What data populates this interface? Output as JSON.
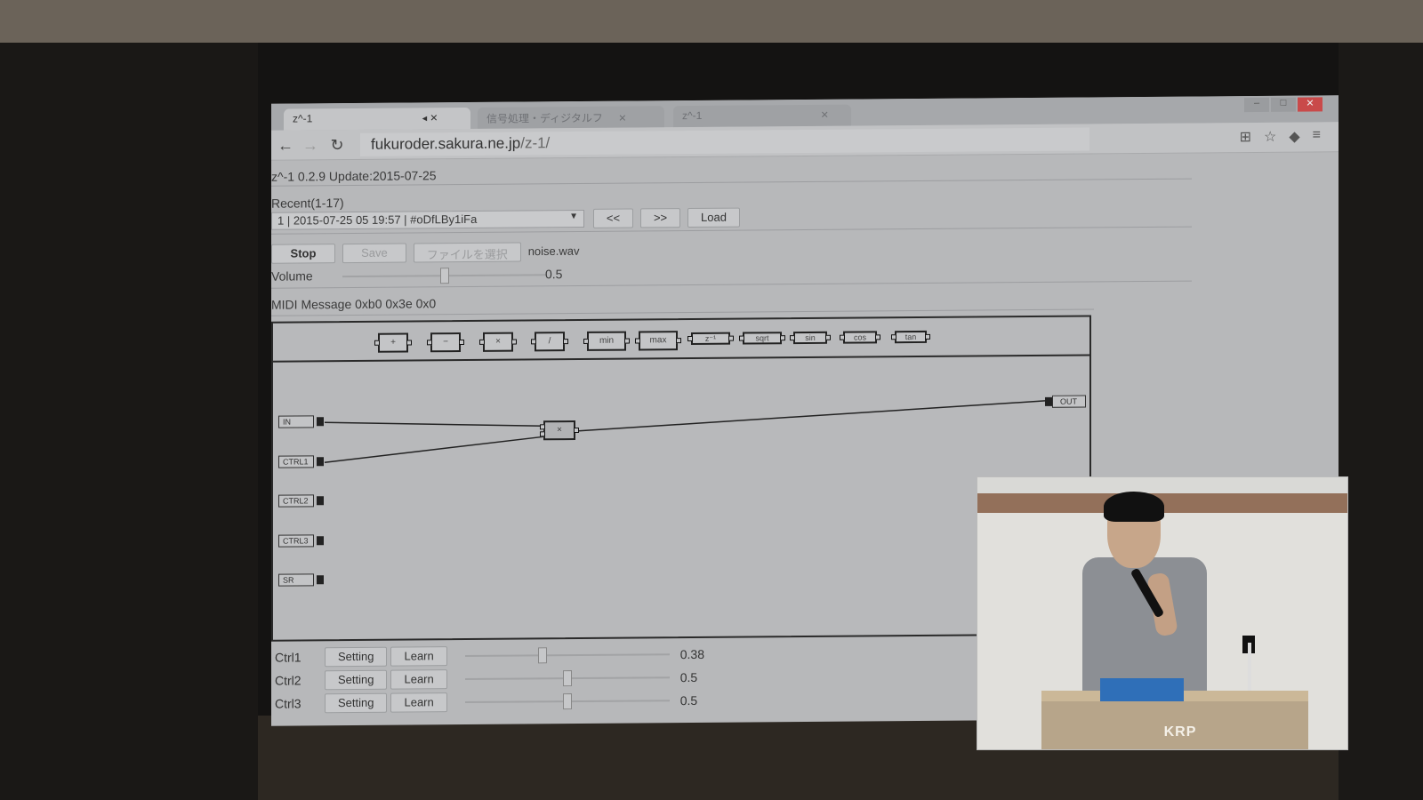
{
  "browser": {
    "tabs": [
      {
        "title": "z^-1",
        "active": true
      },
      {
        "title": "信号処理・ディジタルフ",
        "active": false
      },
      {
        "title": "z^-1",
        "active": false
      }
    ],
    "url_host": "fukuroder.sakura.ne.jp",
    "url_path": "/z-1/"
  },
  "page": {
    "version_line": "z^-1 0.2.9 Update:2015-07-25",
    "recent_label": "Recent(1-17)",
    "recent_selected": "1 | 2015-07-25 05 19:57 | #oDfLBy1iFa",
    "prev_label": "<<",
    "next_label": ">>",
    "load_label": "Load",
    "stop_label": "Stop",
    "save_label": "Save",
    "file_label": "ファイルを選択",
    "file_name": "noise.wav",
    "volume_label": "Volume",
    "volume_value": "0.5",
    "volume_level": 0.5,
    "midi_message": "MIDI Message 0xb0 0x3e 0x0"
  },
  "palette": [
    {
      "label": "+"
    },
    {
      "label": "−"
    },
    {
      "label": "×"
    },
    {
      "label": "/"
    },
    {
      "label": "min"
    },
    {
      "label": "max"
    },
    {
      "label": "z⁻¹"
    },
    {
      "label": "sqrt"
    },
    {
      "label": "sin"
    },
    {
      "label": "cos"
    },
    {
      "label": "tan"
    }
  ],
  "patch": {
    "inputs": [
      "IN",
      "CTRL1",
      "CTRL2",
      "CTRL3",
      "SR"
    ],
    "output": "OUT",
    "node_label": "×"
  },
  "controls": [
    {
      "label": "Ctrl1",
      "setting": "Setting",
      "learn": "Learn",
      "value": "0.38",
      "level": 0.38
    },
    {
      "label": "Ctrl2",
      "setting": "Setting",
      "learn": "Learn",
      "value": "0.5",
      "level": 0.5
    },
    {
      "label": "Ctrl3",
      "setting": "Setting",
      "learn": "Learn",
      "value": "0.5",
      "level": 0.5
    }
  ],
  "video": {
    "podium_logo": "KRP"
  }
}
